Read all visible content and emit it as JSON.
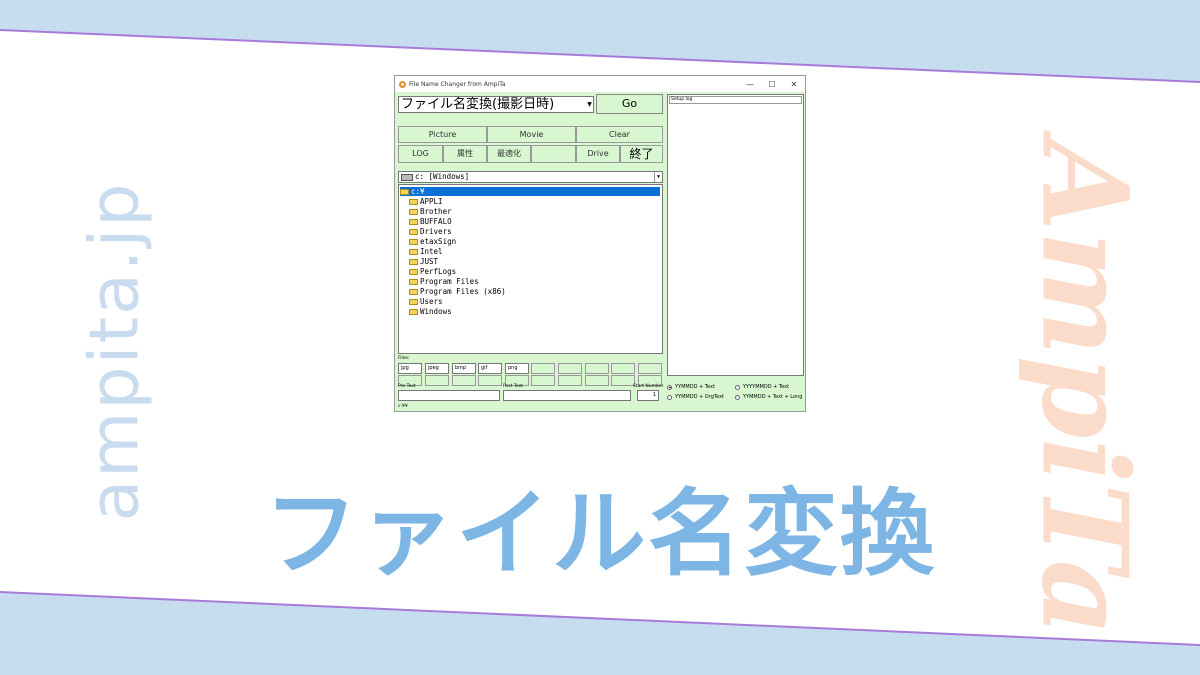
{
  "colors": {
    "band_top": "#c6ddef",
    "band_bottom": "#c6ddef",
    "accent_line": "#a87bdb",
    "title_blue": "#7db6e4",
    "brand_peach": "#fbdccb",
    "window_green": "#d8f7d0",
    "selection_blue": "#0a70d6"
  },
  "banner": {
    "title": "ファイル名変換",
    "side_left": "ampita.jp",
    "side_right": "AmpiTa"
  },
  "window": {
    "title": "File Name Changer from AmpiTa",
    "controls": {
      "minimize": "—",
      "maximize": "☐",
      "close": "✕"
    },
    "mode_select": "ファイル名変換(撮影日時)",
    "go_label": "Go",
    "buttons_row1": [
      "Picture",
      "Movie",
      "Clear"
    ],
    "buttons_row2": [
      "LOG",
      "属性",
      "最適化",
      "",
      "Drive",
      "終了"
    ],
    "drive_select": "c: [Windows]",
    "tree": {
      "root": "c:¥",
      "folders": [
        "APPLI",
        "Brother",
        "BUFFALO",
        "Drivers",
        "etaxSign",
        "Intel",
        "JUST",
        "PerfLogs",
        "Program Files",
        "Program Files (x86)",
        "Users",
        "Windows"
      ]
    },
    "files_label": "Files:",
    "extensions": [
      "jpg",
      "jpeg",
      "bmp",
      "gif",
      "png",
      "",
      "",
      "",
      "",
      ""
    ],
    "pre_text_label": "Pre Text",
    "post_text_label": "Post Text",
    "start_number_label": "Start Number",
    "start_number_value": "1",
    "status_path": "c:¥¥",
    "log_header": "Setup log",
    "radio_options": [
      {
        "label": "YYMMDD + Text",
        "selected": true
      },
      {
        "label": "YYYYMMDD + Text",
        "selected": false
      },
      {
        "label": "YYMMDD + OrgText",
        "selected": false
      },
      {
        "label": "YYMMDD + Text + Long",
        "selected": false
      }
    ]
  }
}
